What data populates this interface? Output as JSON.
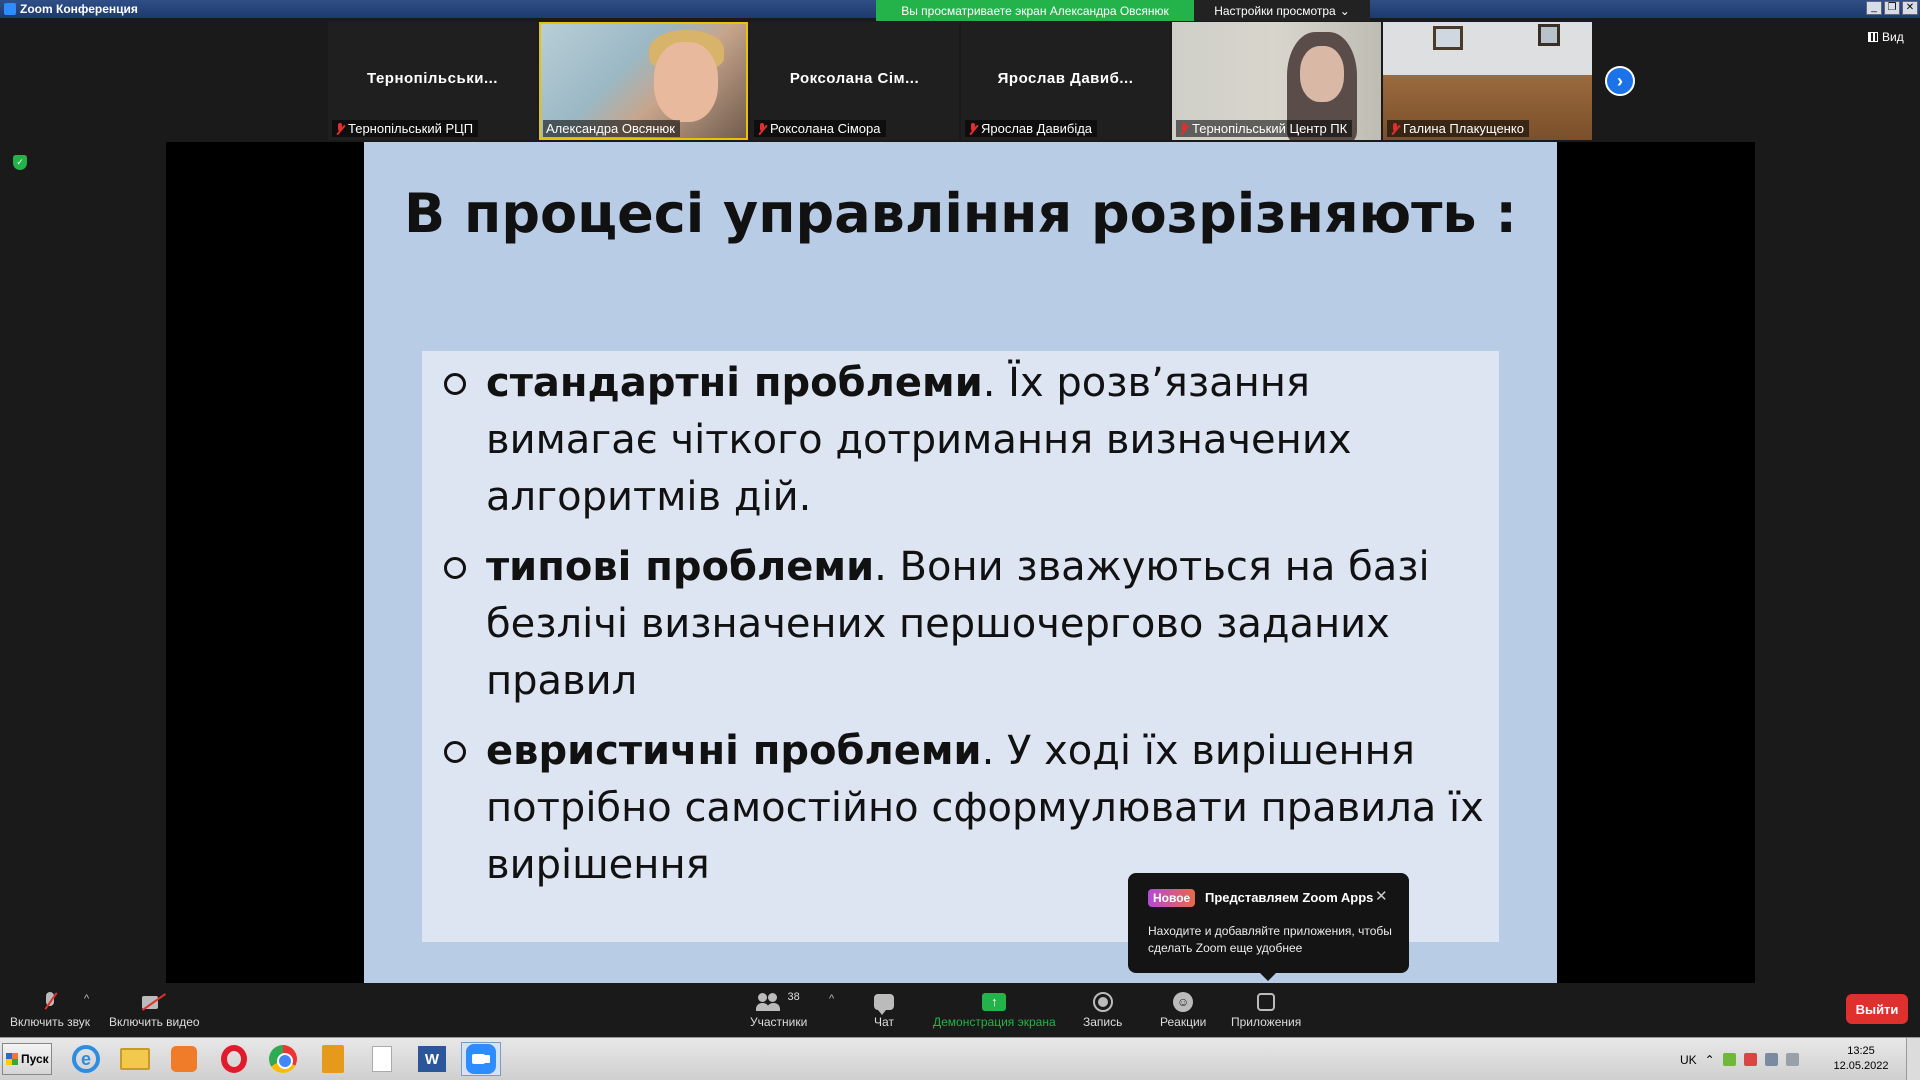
{
  "window": {
    "title": "Zoom Конференция",
    "share_banner": "Вы просматриваете экран Александра Овсянюк",
    "view_settings": "Настройки просмотра",
    "view_button": "Вид"
  },
  "gallery": [
    {
      "big_name": "Тернопільськи...",
      "label": "Тернопільський РЦП",
      "muted": true
    },
    {
      "big_name": "",
      "label": "Александра Овсянюк",
      "muted": false,
      "active": true
    },
    {
      "big_name": "Роксолана Сім...",
      "label": "Роксолана Сімора",
      "muted": true
    },
    {
      "big_name": "Ярослав Давиб...",
      "label": "Ярослав Давибіда",
      "muted": true
    },
    {
      "big_name": "",
      "label": "Тернопільський Центр ПК",
      "muted": true
    },
    {
      "big_name": "",
      "label": "Галина Плакущенко",
      "muted": true
    }
  ],
  "slide": {
    "title": "В процесі управління розрізняють :",
    "bullets": [
      {
        "bold": "стандартні проблеми",
        "rest": ". Їх розв’язання вимагає чіткого дотримання визначених алгоритмів дій."
      },
      {
        "bold": "типові проблеми",
        "rest": ". Вони зважуються на базі безлічі визначених першочергово заданих правил"
      },
      {
        "bold": "евристичні проблеми",
        "rest": ". У ході їх вирішення потрібно самостійно сформулювати правила їх вирішення"
      }
    ]
  },
  "notification": {
    "badge": "Новое",
    "title": "Представляем Zoom Apps",
    "close": "✕",
    "body": "Находите и добавляйте приложения, чтобы сделать Zoom еще удобнее"
  },
  "toolbar": {
    "audio": "Включить звук",
    "video": "Включить видео",
    "participants": "Участники",
    "participants_count": "38",
    "chat": "Чат",
    "share": "Демонстрация экрана",
    "record": "Запись",
    "reactions": "Реакции",
    "apps": "Приложения",
    "leave": "Выйти"
  },
  "taskbar": {
    "start": "Пуск",
    "lang": "UK",
    "time": "13:25",
    "date": "12.05.2022"
  },
  "colors": {
    "share_green": "#23b34a",
    "leave_red": "#e0302e",
    "slide_bg": "#b9cce6",
    "zoom_blue": "#2d8cff"
  }
}
